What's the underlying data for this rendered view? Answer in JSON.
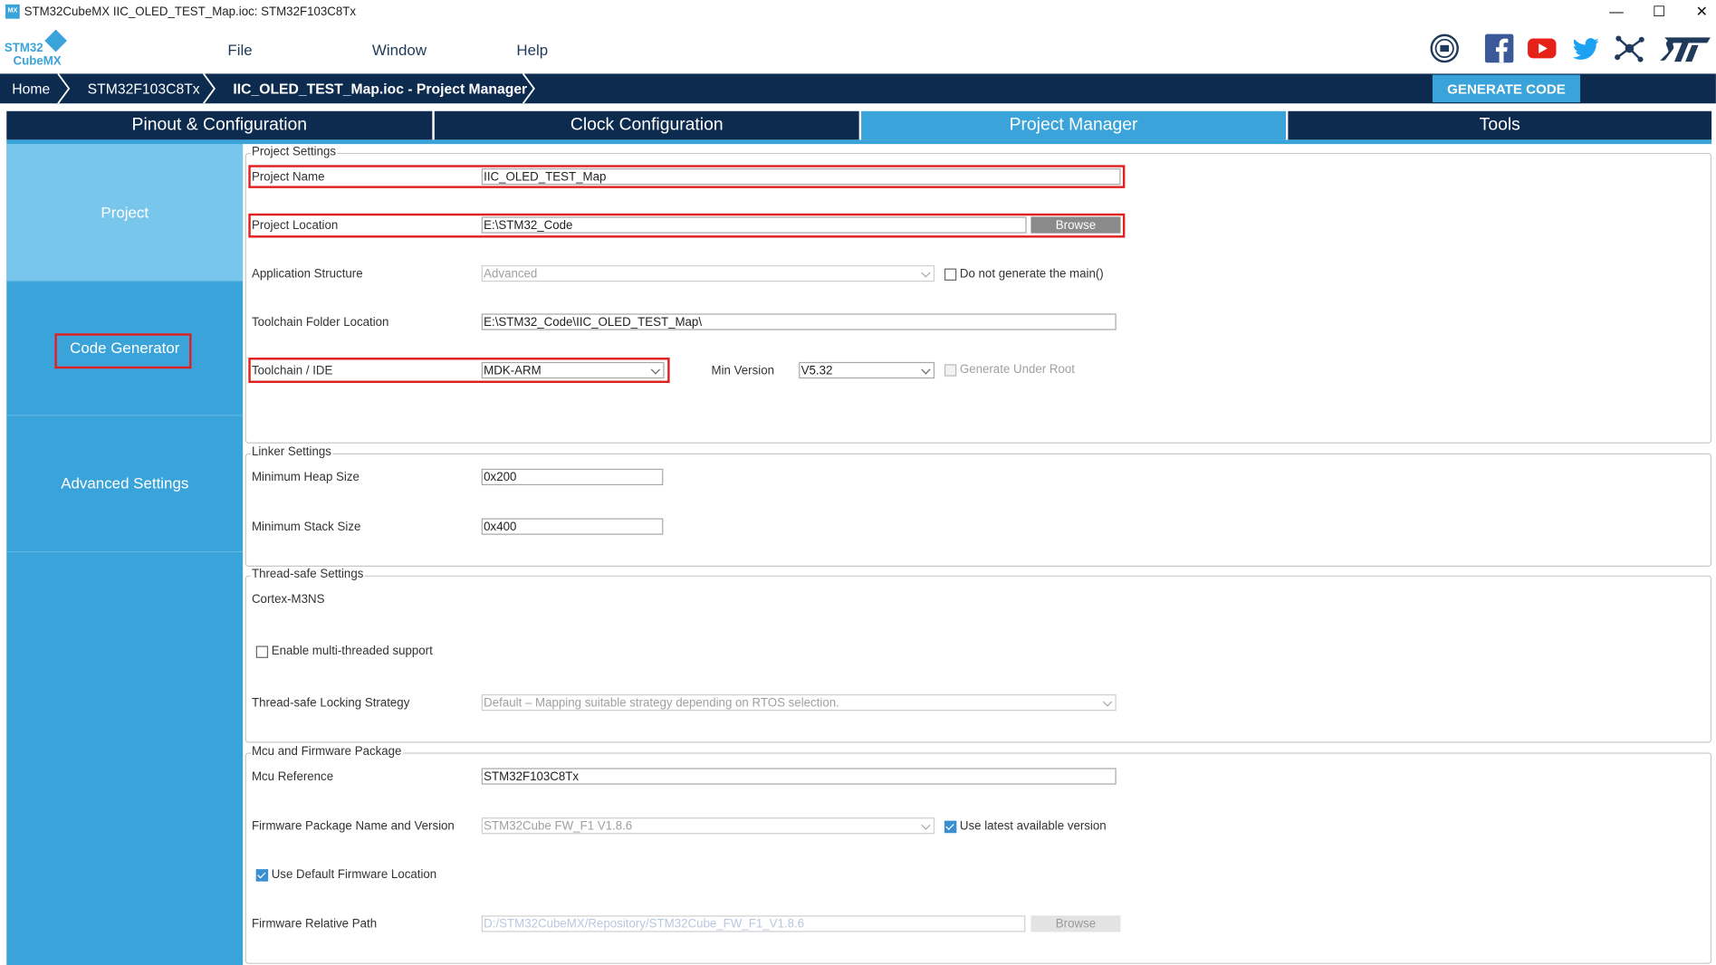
{
  "window": {
    "icon_text": "MX",
    "title": "STM32CubeMX IIC_OLED_TEST_Map.ioc: STM32F103C8Tx",
    "minimize": "—",
    "maximize": "☐",
    "close": "✕"
  },
  "logo": {
    "line1": "STM32",
    "line2": "CubeMX"
  },
  "menu": [
    "File",
    "Window",
    "Help"
  ],
  "social_icons": [
    "anniversary-badge-icon",
    "facebook-icon",
    "youtube-icon",
    "twitter-icon",
    "network-icon",
    "st-logo-icon"
  ],
  "breadcrumb": [
    "Home",
    "STM32F103C8Tx",
    "IIC_OLED_TEST_Map.ioc - Project Manager"
  ],
  "generate_code": "GENERATE CODE",
  "tabs": [
    "Pinout & Configuration",
    "Clock Configuration",
    "Project Manager",
    "Tools"
  ],
  "active_tab": "Project Manager",
  "nav": [
    "Project",
    "Code Generator",
    "Advanced Settings"
  ],
  "colors": {
    "accent": "#3aa3d9",
    "dark": "#0d2b4e",
    "highlight": "#e02020"
  },
  "project_settings": {
    "title": "Project Settings",
    "project_name_label": "Project Name",
    "project_name_value": "IIC_OLED_TEST_Map",
    "project_location_label": "Project Location",
    "project_location_value": "E:\\STM32_Code",
    "browse": "Browse",
    "app_structure_label": "Application Structure",
    "app_structure_value": "Advanced",
    "no_main_label": "Do not generate the main()",
    "toolchain_folder_label": "Toolchain Folder Location",
    "toolchain_folder_value": "E:\\STM32_Code\\IIC_OLED_TEST_Map\\",
    "toolchain_ide_label": "Toolchain / IDE",
    "toolchain_ide_value": "MDK-ARM",
    "min_version_label": "Min Version",
    "min_version_value": "V5.32",
    "gen_under_root_label": "Generate Under Root"
  },
  "linker_settings": {
    "title": "Linker Settings",
    "heap_label": "Minimum Heap Size",
    "heap_value": "0x200",
    "stack_label": "Minimum Stack Size",
    "stack_value": "0x400"
  },
  "thread_settings": {
    "title": "Thread-safe Settings",
    "core": "Cortex-M3NS",
    "multithread_label": "Enable multi-threaded support",
    "locking_label": "Thread-safe Locking Strategy",
    "locking_value": "Default  –  Mapping suitable strategy depending on RTOS selection."
  },
  "mcu_settings": {
    "title": "Mcu and Firmware Package",
    "mcu_ref_label": "Mcu Reference",
    "mcu_ref_value": "STM32F103C8Tx",
    "fw_label": "Firmware Package Name and Version",
    "fw_value": "STM32Cube FW_F1 V1.8.6",
    "latest_label": "Use latest available version",
    "default_loc_label": "Use Default Firmware Location",
    "rel_path_label": "Firmware Relative Path",
    "rel_path_value": "D:/STM32CubeMX/Repository/STM32Cube_FW_F1_V1.8.6",
    "browse": "Browse"
  }
}
